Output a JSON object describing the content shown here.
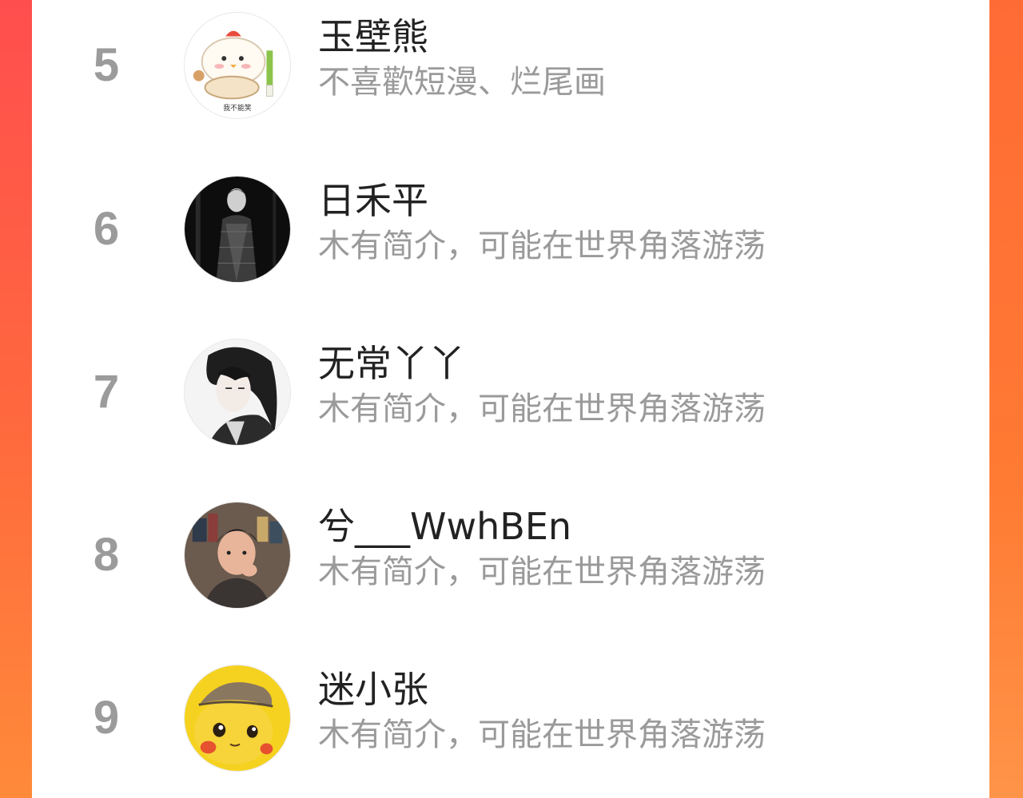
{
  "ranking": {
    "items": [
      {
        "rank": "5",
        "name": "玉壁熊",
        "bio": "不喜歡短漫、烂尾画",
        "avatar_icon": "cartoon-chicken-avatar",
        "avatar_text": "我不能笑"
      },
      {
        "rank": "6",
        "name": "日禾平",
        "bio": "木有简介，可能在世界角落游荡",
        "avatar_icon": "bw-portrait-avatar"
      },
      {
        "rank": "7",
        "name": "无常丫丫",
        "bio": "木有简介，可能在世界角落游荡",
        "avatar_icon": "anime-character-avatar"
      },
      {
        "rank": "8",
        "name": "兮___WwhBEn",
        "bio": "木有简介，可能在世界角落游荡",
        "avatar_icon": "illustrated-boy-avatar"
      },
      {
        "rank": "9",
        "name": "迷小张",
        "bio": "木有简介，可能在世界角落游荡",
        "avatar_icon": "pikachu-avatar"
      }
    ]
  },
  "colors": {
    "left_bar": "#ff4e4e",
    "right_bar": "#ff7a33",
    "rank": "#9b9b9b",
    "name": "#222222",
    "bio": "#9a9a9a"
  }
}
